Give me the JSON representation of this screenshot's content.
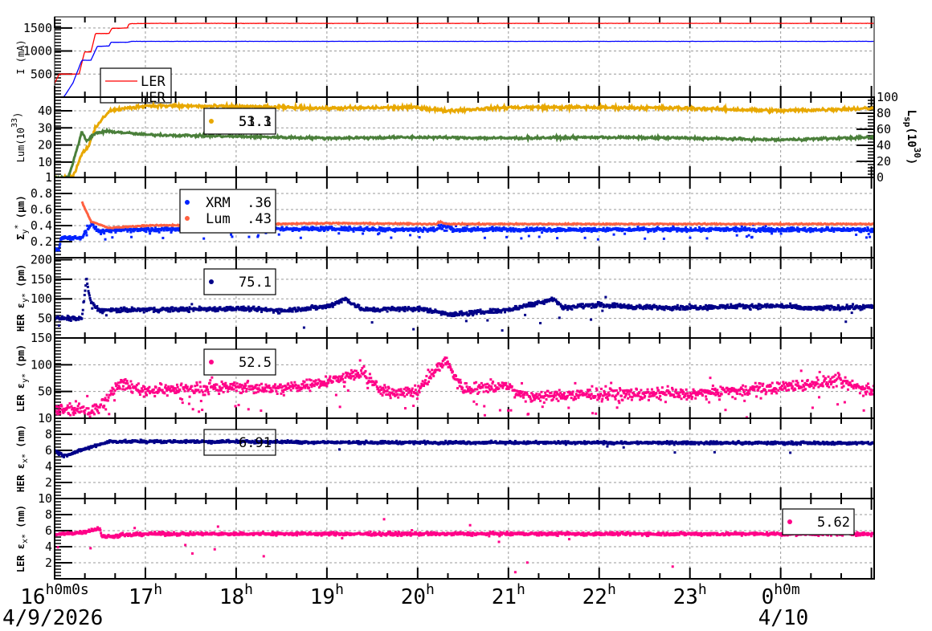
{
  "chart_data": {
    "type": "line",
    "x_unit": "hours since 16h 4/9/2026",
    "xlim": [
      0,
      9.03
    ],
    "x_ticks": [
      {
        "x": 0,
        "label": "16",
        "sup": "h0m0s",
        "date": "4/9/2026"
      },
      {
        "x": 1,
        "label": "17",
        "sup": "h"
      },
      {
        "x": 2,
        "label": "18",
        "sup": "h"
      },
      {
        "x": 3,
        "label": "19",
        "sup": "h"
      },
      {
        "x": 4,
        "label": "20",
        "sup": "h"
      },
      {
        "x": 5,
        "label": "21",
        "sup": "h"
      },
      {
        "x": 6,
        "label": "22",
        "sup": "h"
      },
      {
        "x": 7,
        "label": "23",
        "sup": "h"
      },
      {
        "x": 8,
        "label": "0",
        "sup": "h0m",
        "date": "4/10"
      }
    ],
    "panels": [
      {
        "ylabel": "I (mA)",
        "ylim": [
          0,
          1741
        ],
        "yticks": [
          500,
          1000,
          1500
        ],
        "series": [
          {
            "name": "LER",
            "style": "line",
            "color": "#ff0000",
            "noise": 3,
            "points": [
              [
                0,
                300
              ],
              [
                0.05,
                500
              ],
              [
                0.27,
                500
              ],
              [
                0.33,
                980
              ],
              [
                0.4,
                980
              ],
              [
                0.45,
                1380
              ],
              [
                0.6,
                1380
              ],
              [
                0.63,
                1490
              ],
              [
                0.8,
                1500
              ],
              [
                0.82,
                1590
              ],
              [
                1,
                1600
              ],
              [
                9.03,
                1600
              ]
            ]
          },
          {
            "name": "HER",
            "style": "line",
            "color": "#0000ff",
            "noise": 2,
            "points": [
              [
                0,
                0
              ],
              [
                0.1,
                0
              ],
              [
                0.2,
                300
              ],
              [
                0.3,
                800
              ],
              [
                0.4,
                800
              ],
              [
                0.47,
                1100
              ],
              [
                0.6,
                1110
              ],
              [
                0.62,
                1190
              ],
              [
                0.8,
                1190
              ],
              [
                0.85,
                1210
              ],
              [
                9.03,
                1210
              ]
            ]
          }
        ],
        "legend": {
          "entries": [
            {
              "label": "LER",
              "color": "#ff0000"
            },
            {
              "label": "HER",
              "color": "#0000ff"
            }
          ]
        }
      },
      {
        "ylabel": "Lum(10",
        "ylabel_sup": "33",
        "ylabel_end": ")",
        "ylim": [
          1,
          48
        ],
        "yticks": [
          1,
          10,
          20,
          30,
          40
        ],
        "right_axis": {
          "label": "L",
          "label_sub": "sp",
          "label_mid": "(10",
          "label_sup": "30",
          "label_end": ")",
          "ylim": [
            0,
            100
          ],
          "yticks": [
            0,
            20,
            40,
            60,
            80,
            100
          ]
        },
        "series": [
          {
            "name": "Lum",
            "style": "line",
            "color": "#e8a800",
            "noise": 0.8,
            "points": [
              [
                0,
                1
              ],
              [
                0.2,
                1
              ],
              [
                0.3,
                15
              ],
              [
                0.38,
                20
              ],
              [
                0.45,
                30
              ],
              [
                0.6,
                40
              ],
              [
                1,
                43
              ],
              [
                2,
                42.5
              ],
              [
                3,
                41.5
              ],
              [
                4,
                42
              ],
              [
                4.3,
                40
              ],
              [
                5,
                42
              ],
              [
                6,
                42
              ],
              [
                7,
                41.5
              ],
              [
                8,
                40
              ],
              [
                9.03,
                41.5
              ]
            ]
          },
          {
            "name": "Lsp",
            "style": "line",
            "color": "#4a7f3a",
            "noise": 0.6,
            "points": [
              [
                0,
                1
              ],
              [
                0.15,
                1
              ],
              [
                0.25,
                18
              ],
              [
                0.3,
                28
              ],
              [
                0.35,
                22
              ],
              [
                0.45,
                27
              ],
              [
                0.6,
                28
              ],
              [
                1,
                26
              ],
              [
                2,
                25
              ],
              [
                3,
                24
              ],
              [
                4,
                24.5
              ],
              [
                5,
                24
              ],
              [
                6,
                24.5
              ],
              [
                7,
                24
              ],
              [
                8,
                23
              ],
              [
                9.03,
                24.5
              ]
            ]
          }
        ],
        "legend": {
          "entries": [
            {
              "label": "53.3",
              "label_overlap": "51.1",
              "color": "#e8a800"
            }
          ]
        }
      },
      {
        "ylabel": "Σ",
        "ylabel_sub": "y",
        "ylabel_sup": "*",
        "ylabel_end": " (μm)",
        "ylim": [
          0,
          1.0
        ],
        "yticks": [
          0.2,
          0.4,
          0.6,
          0.8
        ],
        "series": [
          {
            "name": "XRM",
            "style": "dots",
            "color": "#0022ff",
            "noise": 0.02,
            "outliers": 0.06,
            "outlier_spread": 0.08,
            "points": [
              [
                0,
                0.1
              ],
              [
                0.05,
                0.1
              ],
              [
                0.07,
                0.25
              ],
              [
                0.3,
                0.25
              ],
              [
                0.4,
                0.42
              ],
              [
                0.5,
                0.32
              ],
              [
                0.8,
                0.35
              ],
              [
                3,
                0.36
              ],
              [
                4.2,
                0.35
              ],
              [
                4.3,
                0.4
              ],
              [
                4.4,
                0.35
              ],
              [
                9.03,
                0.35
              ]
            ]
          },
          {
            "name": "Lum",
            "style": "line",
            "color": "#ff6040",
            "noise": 0.006,
            "start": 0.3,
            "points": [
              [
                0.3,
                0.7
              ],
              [
                0.4,
                0.45
              ],
              [
                0.6,
                0.37
              ],
              [
                1,
                0.4
              ],
              [
                3,
                0.43
              ],
              [
                4.2,
                0.42
              ],
              [
                4.25,
                0.45
              ],
              [
                4.3,
                0.42
              ],
              [
                9.03,
                0.42
              ]
            ]
          }
        ],
        "legend": {
          "entries": [
            {
              "label": "XRM",
              "value": ".36",
              "color": "#0022ff"
            },
            {
              "label": "Lum",
              "value": ".43",
              "color": "#ff6040"
            }
          ]
        }
      },
      {
        "ylabel": "HER ε",
        "ylabel_sub": "y*",
        "ylabel_end": " (pm)",
        "ylim": [
          0,
          205
        ],
        "yticks": [
          50,
          100,
          150,
          200
        ],
        "series": [
          {
            "name": "HER εy*",
            "style": "dots",
            "color": "#000088",
            "noise": 5,
            "outliers": 0.02,
            "outlier_spread": 40,
            "points": [
              [
                0,
                50
              ],
              [
                0.3,
                50
              ],
              [
                0.35,
                150
              ],
              [
                0.4,
                90
              ],
              [
                0.5,
                70
              ],
              [
                1,
                72
              ],
              [
                2,
                75
              ],
              [
                2.5,
                70
              ],
              [
                3,
                80
              ],
              [
                3.2,
                100
              ],
              [
                3.4,
                72
              ],
              [
                4,
                75
              ],
              [
                4.4,
                60
              ],
              [
                5,
                72
              ],
              [
                5.5,
                100
              ],
              [
                5.6,
                78
              ],
              [
                6,
                85
              ],
              [
                6.5,
                78
              ],
              [
                7,
                78
              ],
              [
                8,
                82
              ],
              [
                8.3,
                75
              ],
              [
                9.03,
                80
              ]
            ]
          }
        ],
        "legend": {
          "entries": [
            {
              "label": "75.1",
              "color": "#000088"
            }
          ]
        }
      },
      {
        "ylabel": "LER ε",
        "ylabel_sub": "y*",
        "ylabel_end": " (pm)",
        "ylim": [
          0,
          150
        ],
        "yticks": [
          50,
          100,
          150
        ],
        "ybottom_label": "10",
        "series": [
          {
            "name": "LER εy*",
            "style": "dots",
            "color": "#ff0088",
            "noise": 9,
            "outliers": 0.08,
            "outlier_spread": 35,
            "points": [
              [
                0,
                15
              ],
              [
                0.4,
                15
              ],
              [
                0.55,
                30
              ],
              [
                0.7,
                65
              ],
              [
                1,
                52
              ],
              [
                2,
                58
              ],
              [
                2.5,
                55
              ],
              [
                3,
                70
              ],
              [
                3.4,
                85
              ],
              [
                3.6,
                50
              ],
              [
                4,
                50
              ],
              [
                4.3,
                110
              ],
              [
                4.5,
                55
              ],
              [
                5,
                60
              ],
              [
                5.2,
                40
              ],
              [
                6,
                45
              ],
              [
                7,
                45
              ],
              [
                8,
                58
              ],
              [
                8.6,
                70
              ],
              [
                9.03,
                50
              ]
            ]
          }
        ],
        "legend": {
          "entries": [
            {
              "label": "52.5",
              "color": "#ff0088"
            }
          ]
        }
      },
      {
        "ylabel": "HER ε",
        "ylabel_sub": "x*",
        "ylabel_end": " (nm)",
        "ylim": [
          0,
          10
        ],
        "yticks": [
          2,
          4,
          6,
          8
        ],
        "series": [
          {
            "name": "HER εx*",
            "style": "dots",
            "color": "#000088",
            "noise": 0.15,
            "outliers": 0.005,
            "outlier_spread": 1,
            "points": [
              [
                0,
                6
              ],
              [
                0.1,
                5.3
              ],
              [
                0.4,
                6.4
              ],
              [
                0.6,
                7.1
              ],
              [
                2,
                7.1
              ],
              [
                3,
                7.0
              ],
              [
                9.03,
                6.9
              ]
            ]
          }
        ],
        "legend": {
          "entries": [
            {
              "label": "6.91",
              "color": "#000088"
            }
          ]
        }
      },
      {
        "ylabel": "LER ε",
        "ylabel_sub": "x*",
        "ylabel_end": " (nm)",
        "ylim": [
          0,
          10
        ],
        "yticks": [
          2,
          4,
          6,
          8,
          10
        ],
        "series": [
          {
            "name": "LER εx*",
            "style": "dots",
            "color": "#ff0088",
            "noise": 0.18,
            "outliers": 0.01,
            "outlier_spread": 3.5,
            "points": [
              [
                0,
                5.5
              ],
              [
                0.3,
                5.8
              ],
              [
                0.5,
                6.3
              ],
              [
                0.52,
                5.2
              ],
              [
                1,
                5.6
              ],
              [
                9.03,
                5.6
              ]
            ]
          }
        ],
        "legend": {
          "entries": [
            {
              "label": "5.62",
              "color": "#ff0088"
            }
          ]
        }
      }
    ]
  }
}
